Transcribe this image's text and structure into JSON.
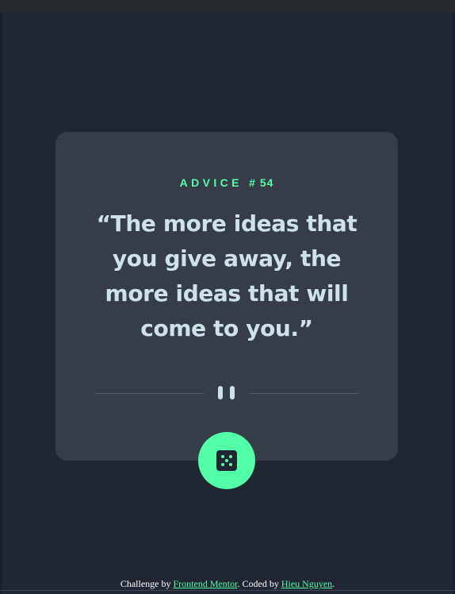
{
  "advice": {
    "label": "ADVICE",
    "number": "# 54",
    "quote": "“The more ideas that you give away, the more ideas that will come to you.”"
  },
  "controls": {
    "dice_icon": "dice-icon"
  },
  "attribution": {
    "prefix": "Challenge by ",
    "link1": "Frontend Mentor",
    "middle": ". Coded by ",
    "link2": "Hieu Nguyen",
    "suffix": "."
  },
  "colors": {
    "background": "#202632",
    "card": "#373c49",
    "accent": "#52ffa8",
    "text": "#cee3e9",
    "divider": "#4f5d74"
  }
}
